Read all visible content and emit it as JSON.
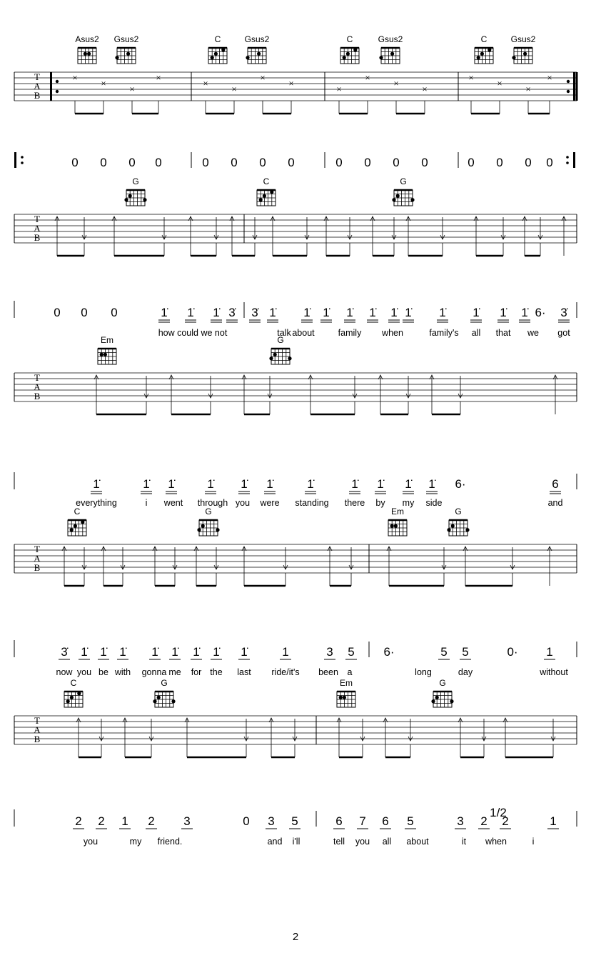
{
  "page_number": "2",
  "tab_letters": [
    "T",
    "A",
    "B"
  ],
  "systems": [
    {
      "chords": [
        "Asus2",
        "Gsus2",
        "C",
        "Gsus2",
        "C",
        "Gsus2",
        "C",
        "Gsus2"
      ],
      "notes": [
        "0",
        "0",
        "0",
        "0",
        "|",
        "0",
        "0",
        "0",
        "0",
        "|",
        "0",
        "0",
        "0",
        "0",
        "|",
        "0",
        "0",
        "0",
        "0"
      ],
      "lyrics": [],
      "repeat_start": true,
      "repeat_end": true
    },
    {
      "chords": [
        "G",
        "C",
        "G"
      ],
      "notes": [
        "0",
        "0",
        "0",
        "1̇",
        "1̇",
        "1̇",
        "3̇",
        "|",
        "3̇",
        "1̇",
        "1̇",
        "1̇",
        "1̇",
        "1̇",
        "1̇",
        "1̇",
        "1̇",
        "1̇",
        "1̇",
        "1̇",
        "6·",
        "3̇",
        "|"
      ],
      "lyrics": [
        "how could we not",
        "talk",
        "about",
        "family",
        "when",
        "family's",
        "all",
        "that",
        "we",
        "got"
      ]
    },
    {
      "chords": [
        "Em",
        "G"
      ],
      "notes": [
        "1̇",
        "1̇",
        "1̇",
        "1̇",
        "1̇",
        "1̇",
        "1̇",
        "1̇",
        "1̇",
        "1̇",
        "1̇",
        "6·",
        "6",
        "|"
      ],
      "lyrics": [
        "everything",
        "i",
        "went",
        "through",
        "you",
        "were",
        "standing",
        "there",
        "by",
        "my",
        "side",
        "and"
      ]
    },
    {
      "chords": [
        "C",
        "G",
        "Em",
        "G"
      ],
      "notes": [
        "3̇",
        "1̇",
        "1̇",
        "1̇",
        "1̇",
        "1̇",
        "1̇",
        "1̇",
        "1̇",
        "1",
        "3",
        "5",
        "|",
        "6·",
        "5",
        "5",
        "0·",
        "1",
        "|"
      ],
      "lyrics": [
        "now",
        "you",
        "be",
        "with",
        "gonna",
        "me",
        "for",
        "the",
        "last",
        "ride/it's",
        "been",
        "a",
        "long",
        "day",
        "without"
      ]
    },
    {
      "chords": [
        "C",
        "G",
        "Em",
        "G"
      ],
      "notes": [
        "2",
        "2",
        "1",
        "2",
        "3",
        "0",
        "3",
        "5",
        "|",
        "6",
        "7",
        "6",
        "5",
        "3",
        "2",
        "2",
        "1",
        "|"
      ],
      "grace_note": "1/2",
      "lyrics": [
        "you",
        "my",
        "friend.",
        "and",
        "i'll",
        "tell",
        "you",
        "all",
        "about",
        "it",
        "when",
        "i"
      ]
    }
  ]
}
